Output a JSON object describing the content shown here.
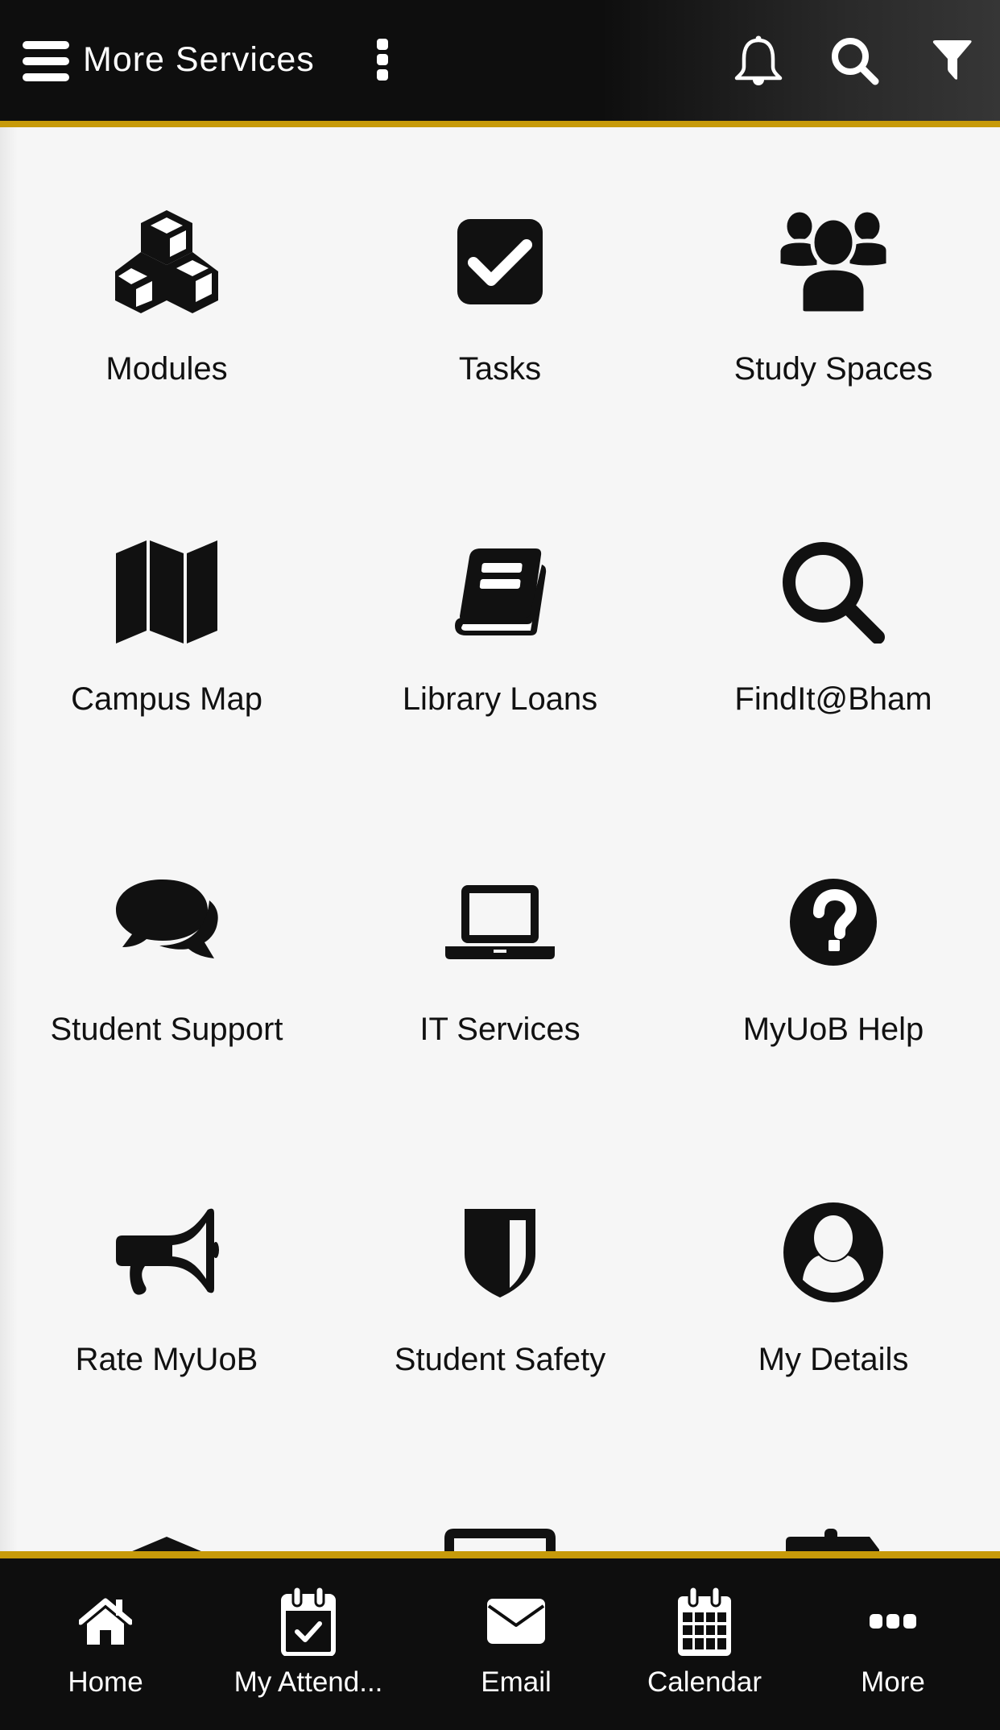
{
  "header": {
    "title": "More Services",
    "icons": {
      "menu": "hamburger-menu-icon",
      "options": "kebab-menu-icon",
      "notifications": "bell-icon",
      "search": "search-icon",
      "filter": "filter-icon"
    }
  },
  "colors": {
    "accent": "#c79a0a",
    "header_bg": "#0e0e0e",
    "content_bg": "#f6f6f6",
    "icon": "#111111"
  },
  "services": [
    {
      "label": "Modules",
      "icon": "cubes-icon"
    },
    {
      "label": "Tasks",
      "icon": "checkbox-icon"
    },
    {
      "label": "Study Spaces",
      "icon": "users-group-icon"
    },
    {
      "label": "Campus Map",
      "icon": "folded-map-icon"
    },
    {
      "label": "Library Loans",
      "icon": "book-icon"
    },
    {
      "label": "FindIt@Bham",
      "icon": "magnifier-icon"
    },
    {
      "label": "Student Support",
      "icon": "chat-bubbles-icon"
    },
    {
      "label": "IT Services",
      "icon": "laptop-icon"
    },
    {
      "label": "MyUoB Help",
      "icon": "question-circle-icon"
    },
    {
      "label": "Rate MyUoB",
      "icon": "megaphone-icon"
    },
    {
      "label": "Student Safety",
      "icon": "shield-icon"
    },
    {
      "label": "My Details",
      "icon": "user-circle-icon"
    }
  ],
  "partial_row_icons": [
    "graduation-cap-icon",
    "monitor-icon",
    "signpost-icon"
  ],
  "bottom_nav": [
    {
      "label": "Home",
      "icon": "home-icon"
    },
    {
      "label": "My Attend...",
      "icon": "calendar-check-icon"
    },
    {
      "label": "Email",
      "icon": "envelope-icon"
    },
    {
      "label": "Calendar",
      "icon": "calendar-grid-icon"
    },
    {
      "label": "More",
      "icon": "more-dots-icon"
    }
  ]
}
